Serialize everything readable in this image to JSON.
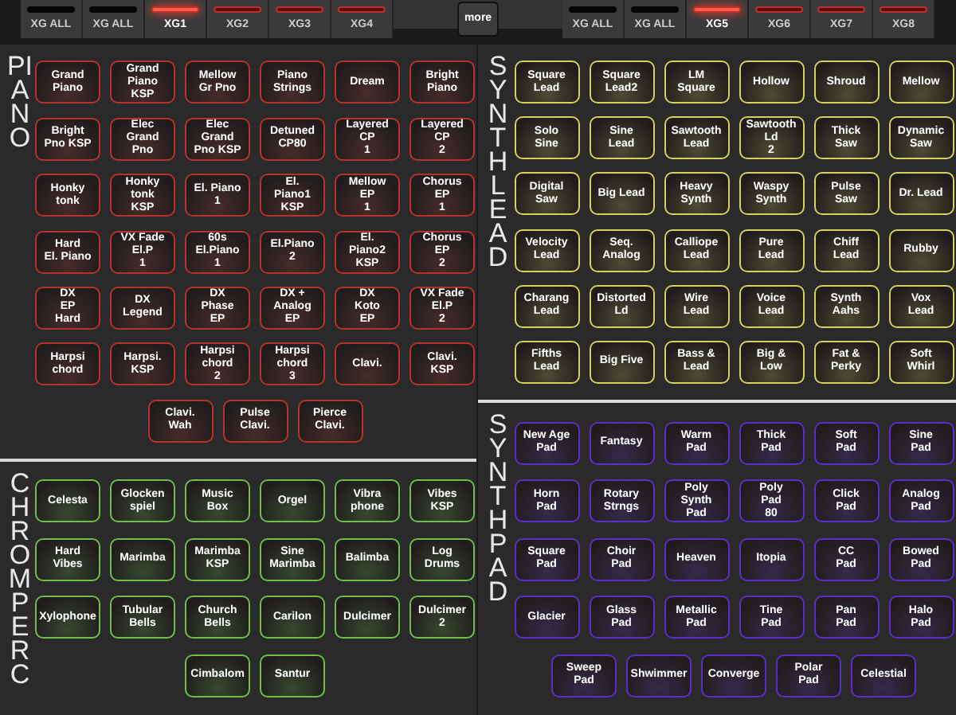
{
  "tabs_left": [
    {
      "label": "XG ALL",
      "kind": "all",
      "selected": false
    },
    {
      "label": "XG ALL",
      "kind": "all",
      "selected": false
    },
    {
      "label": "XG1",
      "kind": "part",
      "selected": true
    },
    {
      "label": "XG2",
      "kind": "part",
      "selected": false
    },
    {
      "label": "XG3",
      "kind": "part",
      "selected": false
    },
    {
      "label": "XG4",
      "kind": "part",
      "selected": false
    }
  ],
  "more_button": "more",
  "tabs_right": [
    {
      "label": "XG ALL",
      "kind": "all",
      "selected": false
    },
    {
      "label": "XG ALL",
      "kind": "all",
      "selected": false
    },
    {
      "label": "XG5",
      "kind": "part",
      "selected": true
    },
    {
      "label": "XG6",
      "kind": "part",
      "selected": false
    },
    {
      "label": "XG7",
      "kind": "part",
      "selected": false
    },
    {
      "label": "XG8",
      "kind": "part",
      "selected": false
    }
  ],
  "columns": [
    [
      {
        "title": "PIANO",
        "color": "#b8322c",
        "rows": [
          [
            "Grand\nPiano",
            "Grand\nPiano\nKSP",
            "Mellow\nGr Pno",
            "Piano\nStrings",
            "Dream",
            "Bright\nPiano"
          ],
          [
            "Bright\nPno KSP",
            "Elec\nGrand\nPno",
            "Elec\nGrand\nPno KSP",
            "Detuned\nCP80",
            "Layered\nCP\n1",
            "Layered\nCP\n2"
          ],
          [
            "Honky\ntonk",
            "Honky\ntonk\nKSP",
            "El. Piano\n1",
            "El.\nPiano1\nKSP",
            "Mellow\nEP\n1",
            "Chorus\nEP\n1"
          ],
          [
            "Hard\nEl. Piano",
            "VX Fade\nEl.P\n1",
            "60s\nEl.Piano\n1",
            "El.Piano\n2",
            "El.\nPiano2\nKSP",
            "Chorus\nEP\n2"
          ],
          [
            "DX\nEP\nHard",
            "DX\nLegend",
            "DX\nPhase\nEP",
            "DX +\nAnalog\nEP",
            "DX\nKoto\nEP",
            "VX Fade\nEl.P\n2"
          ],
          [
            "Harpsi\nchord",
            "Harpsi.\nKSP",
            "Harpsi\nchord\n2",
            "Harpsi\nchord\n3",
            "Clavi.",
            "Clavi.\nKSP"
          ],
          [
            "Clavi.\nWah",
            "Pulse\nClavi.",
            "Pierce\nClavi."
          ]
        ]
      },
      {
        "title": "CHROM PERC",
        "color": "#6cc04a",
        "rows": [
          [
            "Celesta",
            "Glocken\nspiel",
            "Music\nBox",
            "Orgel",
            "Vibra\nphone",
            "Vibes\nKSP"
          ],
          [
            "Hard\nVibes",
            "Marimba",
            "Marimba\nKSP",
            "Sine\nMarimba",
            "Balimba",
            "Log\nDrums"
          ],
          [
            "Xylophone",
            "Tubular\nBells",
            "Church\nBells",
            "Carilon",
            "Dulcimer",
            "Dulcimer\n2"
          ],
          [
            "",
            "",
            "Cimbalom",
            "Santur",
            "",
            ""
          ]
        ]
      }
    ],
    [
      {
        "title": "SYNTH LEAD",
        "color": "#d2d25c",
        "rows": [
          [
            "Square\nLead",
            "Square\nLead2",
            "LM\nSquare",
            "Hollow",
            "Shroud",
            "Mellow"
          ],
          [
            "Solo\nSine",
            "Sine\nLead",
            "Sawtooth\nLead",
            "Sawtooth\nLd\n2",
            "Thick\nSaw",
            "Dynamic\nSaw"
          ],
          [
            "Digital\nSaw",
            "Big Lead",
            "Heavy\nSynth",
            "Waspy\nSynth",
            "Pulse\nSaw",
            "Dr. Lead"
          ],
          [
            "Velocity\nLead",
            "Seq.\nAnalog",
            "Calliope\nLead",
            "Pure\nLead",
            "Chiff\nLead",
            "Rubby"
          ],
          [
            "Charang\nLead",
            "Distorted\nLd",
            "Wire\nLead",
            "Voice\nLead",
            "Synth\nAahs",
            "Vox\nLead"
          ],
          [
            "Fifths\nLead",
            "Big Five",
            "Bass &\nLead",
            "Big &\nLow",
            "Fat &\nPerky",
            "Soft\nWhirl"
          ]
        ]
      },
      {
        "title": "SYNTH PAD",
        "color": "#5a2ec8",
        "rows": [
          [
            "New Age\nPad",
            "Fantasy",
            "Warm\nPad",
            "Thick\nPad",
            "Soft\nPad",
            "Sine\nPad"
          ],
          [
            "Horn\nPad",
            "Rotary\nStrngs",
            "Poly\nSynth\nPad",
            "Poly\nPad\n80",
            "Click\nPad",
            "Analog\nPad"
          ],
          [
            "Square\nPad",
            "Choir\nPad",
            "Heaven",
            "Itopia",
            "CC\nPad",
            "Bowed\nPad"
          ],
          [
            "Glacier",
            "Glass\nPad",
            "Metallic\nPad",
            "Tine\nPad",
            "Pan\nPad",
            "Halo\nPad"
          ],
          [
            "Sweep\nPad",
            "Shwimmer",
            "Converge",
            "Polar\nPad",
            "Celestial"
          ]
        ]
      }
    ]
  ]
}
